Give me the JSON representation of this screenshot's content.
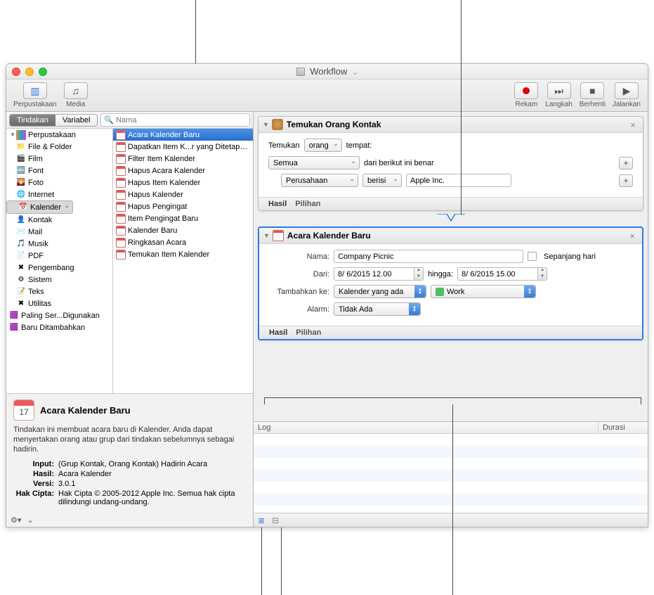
{
  "window": {
    "title": "Workflow"
  },
  "toolbar": {
    "library": "Perpustakaan",
    "media": "Media",
    "record": "Rekam",
    "step": "Langkah",
    "stop": "Berhenti",
    "run": "Jalankan"
  },
  "library": {
    "tab_actions": "Tindakan",
    "tab_variables": "Variabel",
    "search_placeholder": "Nama",
    "categories": [
      {
        "label": "Perpustakaan",
        "icon": "book",
        "expandable": true
      },
      {
        "label": "File & Folder",
        "icon": "folder",
        "indent": 1
      },
      {
        "label": "Film",
        "icon": "film",
        "indent": 1
      },
      {
        "label": "Font",
        "icon": "font",
        "indent": 1
      },
      {
        "label": "Foto",
        "icon": "foto",
        "indent": 1
      },
      {
        "label": "Internet",
        "icon": "internet",
        "indent": 1
      },
      {
        "label": "Kalender",
        "icon": "calendar",
        "indent": 1,
        "selected": true
      },
      {
        "label": "Kontak",
        "icon": "contact",
        "indent": 1
      },
      {
        "label": "Mail",
        "icon": "mail",
        "indent": 1
      },
      {
        "label": "Musik",
        "icon": "music",
        "indent": 1
      },
      {
        "label": "PDF",
        "icon": "pdf",
        "indent": 1
      },
      {
        "label": "Pengembang",
        "icon": "dev",
        "indent": 1
      },
      {
        "label": "Sistem",
        "icon": "sys",
        "indent": 1
      },
      {
        "label": "Teks",
        "icon": "text",
        "indent": 1
      },
      {
        "label": "Utilitas",
        "icon": "util",
        "indent": 1
      },
      {
        "label": "Paling Ser...Digunakan",
        "icon": "purple"
      },
      {
        "label": "Baru Ditambahkan",
        "icon": "purple"
      }
    ],
    "actions": [
      {
        "label": "Acara Kalender Baru",
        "selected": true
      },
      {
        "label": "Dapatkan Item K...r yang Ditetapkan"
      },
      {
        "label": "Filter Item Kalender"
      },
      {
        "label": "Hapus Acara Kalender"
      },
      {
        "label": "Hapus Item Kalender"
      },
      {
        "label": "Hapus Kalender"
      },
      {
        "label": "Hapus Pengingat"
      },
      {
        "label": "Item Pengingat Baru"
      },
      {
        "label": "Kalender Baru"
      },
      {
        "label": "Ringkasan Acara"
      },
      {
        "label": "Temukan Item Kalender"
      }
    ]
  },
  "description": {
    "title": "Acara Kalender Baru",
    "body": "Tindakan ini membuat acara baru di Kalender. Anda dapat menyertakan orang atau grup dari tindakan sebelumnya sebagai hadirin.",
    "input_label": "Input:",
    "input_value": "(Grup Kontak, Orang Kontak) Hadirin Acara",
    "result_label": "Hasil:",
    "result_value": "Acara Kalender",
    "version_label": "Versi:",
    "version_value": "3.0.1",
    "copyright_label": "Hak Cipta:",
    "copyright_value": "Hak Cipta © 2005-2012 Apple Inc.  Semua hak cipta dilindungi undang-undang."
  },
  "workflow": {
    "action1": {
      "title": "Temukan Orang Kontak",
      "find_label": "Temukan",
      "find_type": "orang",
      "find_where": "tempat:",
      "cond_all": "Semua",
      "cond_following": "dari berikut ini benar",
      "cond_field": "Perusahaan",
      "cond_op": "berisi",
      "cond_value": "Apple Inc.",
      "results": "Hasil",
      "options": "Pilihan"
    },
    "action2": {
      "title": "Acara Kalender Baru",
      "name_label": "Nama:",
      "name_value": "Company Picnic",
      "allday_label": "Sepanjang hari",
      "from_label": "Dari:",
      "from_value": "8/ 6/2015 12.00",
      "to_label": "hingga:",
      "to_value": "8/ 6/2015 15.00",
      "addto_label": "Tambahkan ke:",
      "addto_value": "Kalender yang ada",
      "calendar_value": "Work",
      "alarm_label": "Alarm:",
      "alarm_value": "Tidak Ada",
      "results": "Hasil",
      "options": "Pilihan"
    }
  },
  "log": {
    "col_log": "Log",
    "col_duration": "Durasi"
  }
}
